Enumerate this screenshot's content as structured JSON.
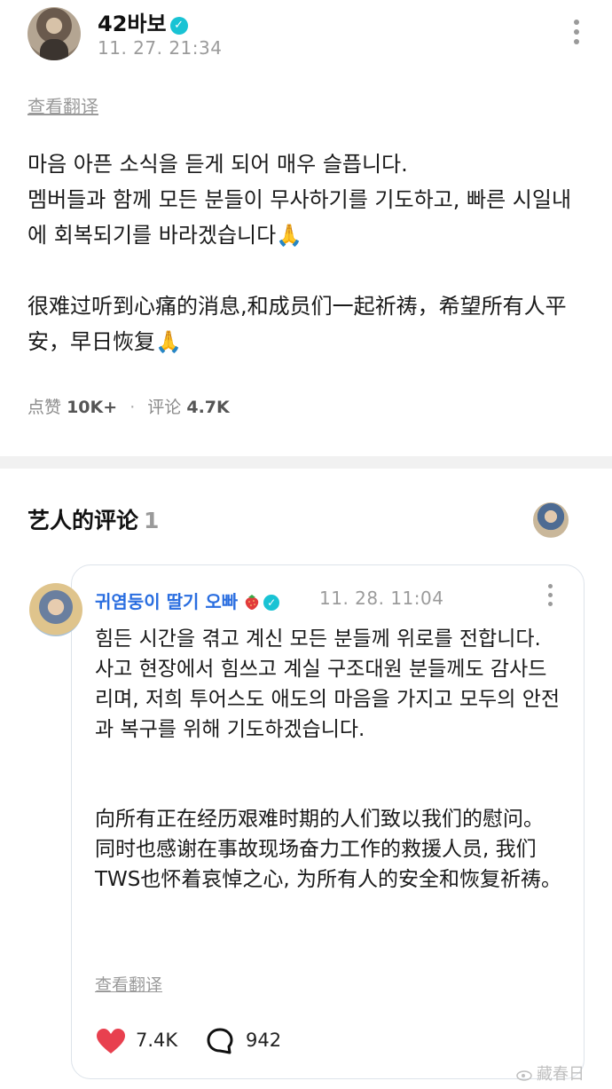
{
  "post": {
    "author": "42바보",
    "time": "11. 27. 21:34",
    "translate_label": "查看翻译",
    "body_ko": "마음 아픈 소식을 듣게 되어 매우 슬픕니다.\n멤버들과 함께 모든 분들이 무사하기를 기도하고, 빠른 시일내에 회복되기를 바라겠습니다🙏",
    "body_cn": "很难过听到心痛的消息,和成员们一起祈祷，希望所有人平安，早日恢复🙏",
    "likes_label": "点赞",
    "likes_count": "10K+",
    "comments_label": "评论",
    "comments_count": "4.7K"
  },
  "artist_comments": {
    "title": "艺人的评论",
    "count": "1"
  },
  "comment": {
    "author": "귀염둥이 딸기 오빠",
    "time": "11. 28. 11:04",
    "body_ko": "힘든 시간을 겪고 계신 모든 분들께 위로를 전합니다.\n사고 현장에서 힘쓰고 계실 구조대원 분들께도 감사드리며, 저희 투어스도 애도의 마음을 가지고 모두의 안전과 복구를 위해 기도하겠습니다.",
    "body_cn": "向所有正在经历艰难时期的人们致以我们的慰问。\n同时也感谢在事故现场奋力工作的救援人员, 我们TWS也怀着哀悼之心, 为所有人的安全和恢复祈祷。",
    "translate_label": "查看翻译",
    "likes": "7.4K",
    "replies": "942"
  },
  "watermark": "藏春日",
  "colors": {
    "verified": "#19c3d4",
    "commenter_name": "#2a6ee0",
    "heart": "#e8404f",
    "muted_text": "#9b9b9b"
  }
}
